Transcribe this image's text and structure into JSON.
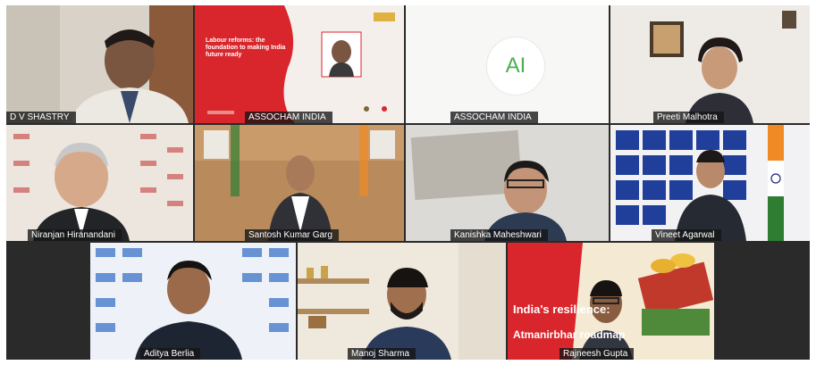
{
  "meeting": {
    "participants": [
      {
        "id": "p1",
        "name": "D V SHASTRY"
      },
      {
        "id": "p2",
        "name": "ASSOCHAM INDIA"
      },
      {
        "id": "p3",
        "name": "ASSOCHAM INDIA",
        "avatar_initials": "AI"
      },
      {
        "id": "p4",
        "name": "Preeti Malhotra"
      },
      {
        "id": "p5",
        "name": "Niranjan Hiranandani"
      },
      {
        "id": "p6",
        "name": "Santosh Kumar Garg"
      },
      {
        "id": "p7",
        "name": "Kanishka Maheshwari"
      },
      {
        "id": "p8",
        "name": "Vineet Agarwal"
      },
      {
        "id": "p9",
        "name": "Aditya Berlia"
      },
      {
        "id": "p10",
        "name": "Manoj Sharma"
      },
      {
        "id": "p11",
        "name": "Rajneesh Gupta"
      }
    ],
    "shared_slide": {
      "title": "Labour reforms: the foundation to making India future ready"
    },
    "background_slide": {
      "title": "India's resilience:",
      "subtitle": "Atmanirbhar roadmap"
    }
  },
  "colors": {
    "grid_background": "#2a2a2a",
    "name_label_bg": "#141414",
    "slide_red": "#d9262c",
    "avatar_green": "#4caf50"
  }
}
